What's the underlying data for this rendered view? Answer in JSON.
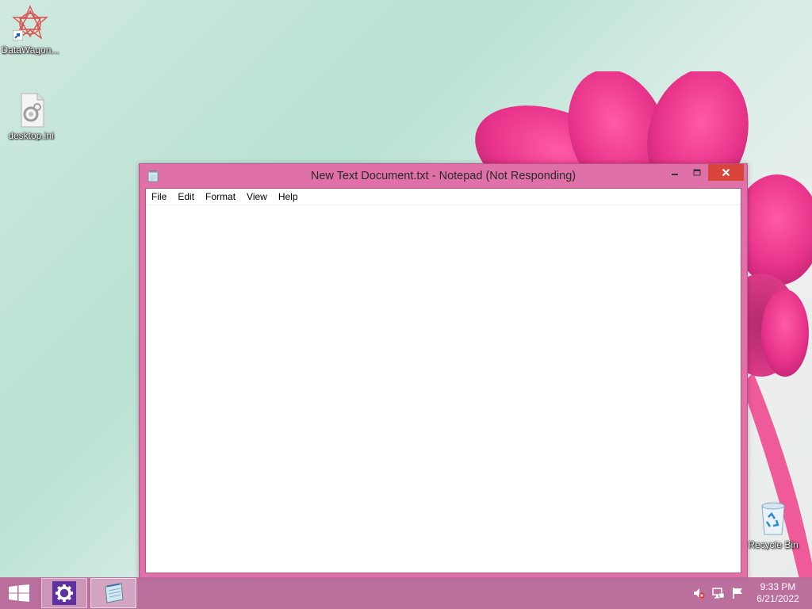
{
  "desktop": {
    "icons": [
      {
        "label": "DataWagon..."
      },
      {
        "label": "desktop.ini"
      },
      {
        "label": "Recycle Bin"
      }
    ]
  },
  "window": {
    "title": "New Text Document.txt - Notepad (Not Responding)",
    "state": "not-responding",
    "menu": [
      "File",
      "Edit",
      "Format",
      "View",
      "Help"
    ],
    "content": "",
    "icons": {
      "app": "notepad-icon",
      "minimize": "minimize-icon",
      "maximize": "maximize-icon",
      "close": "close-icon"
    }
  },
  "taskbar": {
    "start_icon": "windows-logo-icon",
    "pinned": [
      {
        "name": "settings",
        "icon": "gear-icon"
      },
      {
        "name": "notepad",
        "icon": "notepad-icon"
      }
    ],
    "tray": [
      "speaker-muted-icon",
      "network-icon",
      "flag-icon"
    ],
    "clock": {
      "time": "9:33 PM",
      "date": "6/21/2022"
    }
  },
  "colors": {
    "window_frame": "#e070a8",
    "close_button": "#d9453b",
    "taskbar": "#b2598e",
    "settings_tile": "#5b2d9e"
  }
}
